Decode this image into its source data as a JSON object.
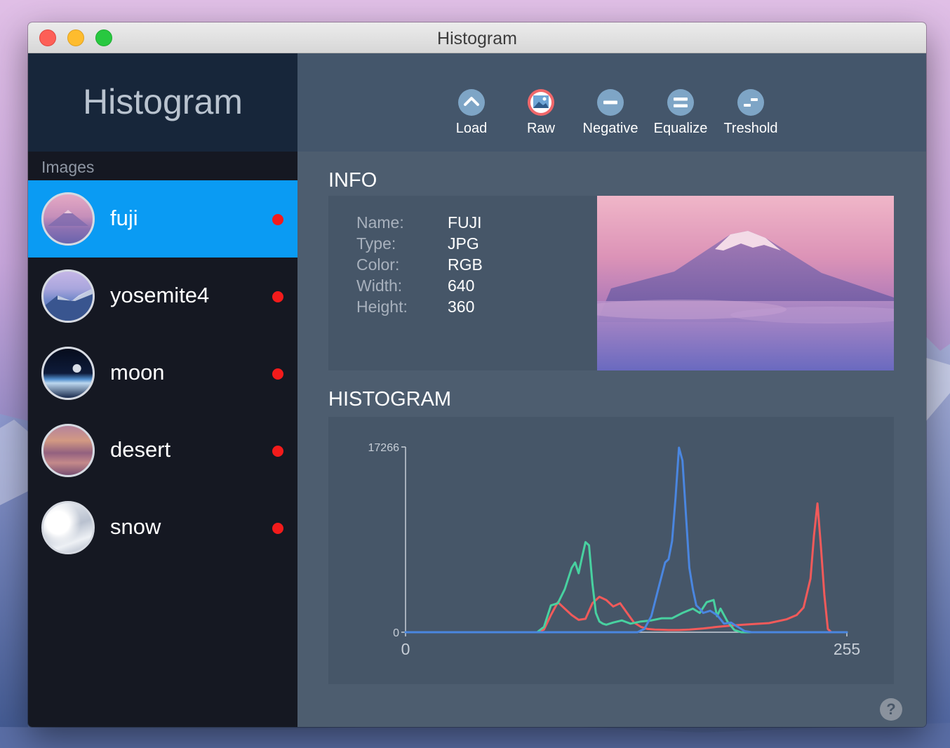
{
  "window": {
    "title": "Histogram"
  },
  "sidebar": {
    "app_title": "Histogram",
    "section_label": "Images",
    "items": [
      {
        "label": "fuji",
        "selected": true
      },
      {
        "label": "yosemite4",
        "selected": false
      },
      {
        "label": "moon",
        "selected": false
      },
      {
        "label": "desert",
        "selected": false
      },
      {
        "label": "snow",
        "selected": false
      }
    ],
    "status_dot_color": "#f31b1b",
    "selected_color": "#0a9bf3"
  },
  "toolbar": {
    "buttons": [
      {
        "label": "Load",
        "icon": "chevron-up-icon"
      },
      {
        "label": "Raw",
        "icon": "image-icon"
      },
      {
        "label": "Negative",
        "icon": "minus-icon"
      },
      {
        "label": "Equalize",
        "icon": "equals-icon"
      },
      {
        "label": "Treshold",
        "icon": "threshold-icon"
      }
    ]
  },
  "info": {
    "title": "INFO",
    "rows": [
      {
        "key": "Name:",
        "value": "FUJI"
      },
      {
        "key": "Type:",
        "value": "JPG"
      },
      {
        "key": "Color:",
        "value": "RGB"
      },
      {
        "key": "Width:",
        "value": "640"
      },
      {
        "key": "Height:",
        "value": "360"
      }
    ]
  },
  "histogram": {
    "title": "HISTOGRAM"
  },
  "help": {
    "label": "?"
  },
  "chart_data": {
    "type": "line",
    "title": "",
    "xlabel": "",
    "ylabel": "",
    "xlim": [
      0,
      255
    ],
    "ylim": [
      0,
      17266
    ],
    "x_tick_labels": [
      "0",
      "255"
    ],
    "y_tick_labels": [
      "0",
      "17266"
    ],
    "series": [
      {
        "color": "#f25a5a",
        "x": [
          0,
          76,
          80,
          84,
          88,
          92,
          96,
          100,
          104,
          108,
          112,
          116,
          120,
          124,
          128,
          132,
          136,
          140,
          144,
          148,
          152,
          158,
          164,
          172,
          180,
          190,
          200,
          210,
          220,
          226,
          230,
          234,
          236,
          238,
          240,
          242,
          244,
          246,
          250,
          255
        ],
        "y": [
          0,
          0,
          250,
          1600,
          2800,
          2200,
          1600,
          1150,
          1250,
          2700,
          3300,
          3000,
          2400,
          2700,
          1800,
          900,
          500,
          300,
          250,
          230,
          200,
          200,
          250,
          350,
          500,
          650,
          750,
          850,
          1200,
          1600,
          2300,
          5000,
          9000,
          12000,
          8000,
          3500,
          300,
          0,
          0,
          0
        ]
      },
      {
        "color": "#48d1a0",
        "x": [
          0,
          76,
          80,
          84,
          88,
          92,
          96,
          98,
          100,
          102,
          104,
          106,
          108,
          110,
          112,
          114,
          116,
          120,
          125,
          130,
          136,
          142,
          148,
          154,
          160,
          166,
          170,
          174,
          178,
          180,
          182,
          186,
          190,
          194,
          196,
          198,
          255
        ],
        "y": [
          0,
          0,
          500,
          2500,
          2700,
          4000,
          6000,
          6500,
          5500,
          7000,
          8400,
          8100,
          4500,
          1800,
          1000,
          800,
          700,
          900,
          1100,
          800,
          1000,
          1100,
          1300,
          1300,
          1800,
          2200,
          1800,
          2800,
          3000,
          1500,
          2200,
          1000,
          200,
          0,
          0,
          0,
          0
        ]
      },
      {
        "color": "#4a86e0",
        "x": [
          0,
          134,
          138,
          142,
          146,
          150,
          152,
          154,
          156,
          158,
          160,
          162,
          164,
          166,
          168,
          170,
          172,
          176,
          180,
          184,
          188,
          192,
          196,
          200,
          255
        ],
        "y": [
          0,
          0,
          300,
          1500,
          4000,
          6500,
          6800,
          8500,
          12500,
          17200,
          16000,
          11000,
          6000,
          4000,
          2500,
          2200,
          1800,
          2000,
          1600,
          800,
          900,
          500,
          100,
          0,
          0
        ]
      }
    ]
  }
}
